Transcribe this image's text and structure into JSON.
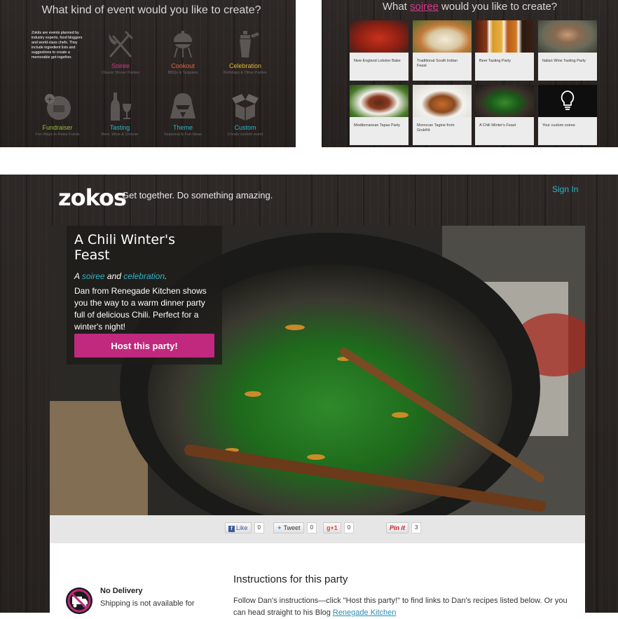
{
  "panel_a": {
    "title": "What kind of event would you like to create?",
    "intro": "Zokits are events planned by industry experts, food bloggers and world-class chefs. They include ingredient lists and suggestions to create a memorable get-together.",
    "categories": [
      {
        "name": "Soiree",
        "sub": "Classic Dinner Parties",
        "color": "#d23a8a",
        "icon": "fork-knife-icon"
      },
      {
        "name": "Cookout",
        "sub": "BBQs & Tailgates",
        "color": "#e8633a",
        "icon": "grill-icon"
      },
      {
        "name": "Celebration",
        "sub": "Birthdays & Other Parties",
        "color": "#e8b52f",
        "icon": "cocktail-shaker-icon"
      },
      {
        "name": "Fundraiser",
        "sub": "Fun Ways to Raise Funds",
        "color": "#8dbd3a",
        "icon": "donation-box-icon"
      },
      {
        "name": "Tasting",
        "sub": "Beer, Wine & Cheese",
        "color": "#2fb3c7",
        "icon": "wine-bottle-icon"
      },
      {
        "name": "Theme",
        "sub": "Seasonal & Fun Ideas",
        "color": "#2fb3c7",
        "icon": "vader-helmet-icon"
      },
      {
        "name": "Custom",
        "sub": "Create custom event",
        "color": "#2fb3c7",
        "icon": "open-box-icon"
      }
    ]
  },
  "panel_b": {
    "title_pre": "What ",
    "title_hl": "soiree",
    "title_post": " would you like to create?",
    "tiles": [
      {
        "caption": "New England Lobster Bake"
      },
      {
        "caption": "Traditional South Indian Feast"
      },
      {
        "caption": "Beer Tasting Party"
      },
      {
        "caption": "Italian Wine Tasting Party"
      },
      {
        "caption": "Mediterranean Tapas Party"
      },
      {
        "caption": "Morrocan Tagine from GrubKit"
      },
      {
        "caption": "A Chili Winter's Feast"
      },
      {
        "caption": "Your custom soiree"
      }
    ]
  },
  "header": {
    "logo": "zokos",
    "tagline": "Get together. Do something amazing.",
    "sign_in": "Sign In"
  },
  "event": {
    "title": "A Chili Winter's Feast",
    "kind_prefix": "A ",
    "kind_1": "soiree",
    "kind_and": " and ",
    "kind_2": "celebration",
    "kind_end": ".",
    "description": "Dan from Renegade Kitchen shows you the way to a warm dinner party full of delicious Chili. Perfect for a winter's night!",
    "host_button": "Host this party!"
  },
  "share": {
    "like_label": "Like",
    "like_count": "0",
    "tweet_label": "Tweet",
    "tweet_count": "0",
    "gplus_label": "+1",
    "gplus_count": "0",
    "pin_label": "Pin it",
    "pin_count": "3"
  },
  "delivery": {
    "title": "No Delivery",
    "text": "Shipping is not available for"
  },
  "instructions": {
    "heading": "Instructions for this party",
    "text": "Follow Dan's instructions—click \"Host this party!\" to find links to Dan's recipes listed below. Or you can head straight to his Blog ",
    "link": "Renegade Kitchen"
  }
}
